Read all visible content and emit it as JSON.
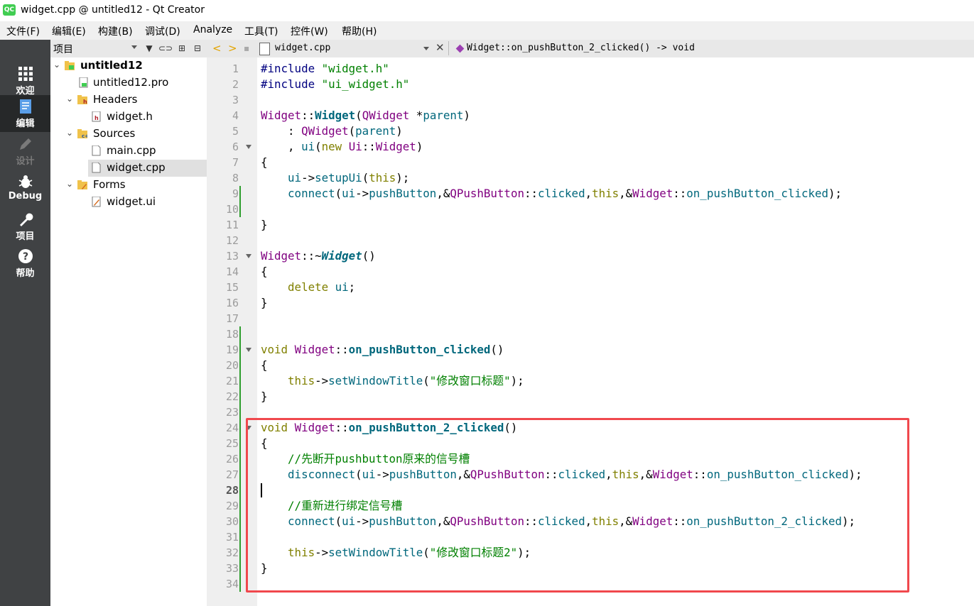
{
  "window": {
    "title": "widget.cpp @ untitled12 - Qt Creator",
    "app_icon_text": "QC"
  },
  "menubar": {
    "items": [
      "文件(F)",
      "编辑(E)",
      "构建(B)",
      "调试(D)",
      "Analyze",
      "工具(T)",
      "控件(W)",
      "帮助(H)"
    ]
  },
  "modebar": {
    "items": [
      {
        "label": "欢迎",
        "icon": "grid-icon"
      },
      {
        "label": "编辑",
        "icon": "document-edit-icon"
      },
      {
        "label": "设计",
        "icon": "pencil-icon"
      },
      {
        "label": "Debug",
        "icon": "bug-icon"
      },
      {
        "label": "项目",
        "icon": "wrench-icon"
      },
      {
        "label": "帮助",
        "icon": "question-icon"
      }
    ],
    "active": "编辑"
  },
  "project_panel": {
    "title": "项目",
    "tree": [
      {
        "label": "untitled12",
        "level": 0,
        "expanded": true,
        "icon": "project-folder-icon"
      },
      {
        "label": "untitled12.pro",
        "level": 1,
        "icon": "pro-file-icon"
      },
      {
        "label": "Headers",
        "level": 1,
        "expanded": true,
        "icon": "headers-folder-icon"
      },
      {
        "label": "widget.h",
        "level": 2,
        "icon": "header-file-icon"
      },
      {
        "label": "Sources",
        "level": 1,
        "expanded": true,
        "icon": "sources-folder-icon"
      },
      {
        "label": "main.cpp",
        "level": 2,
        "icon": "cpp-file-icon"
      },
      {
        "label": "widget.cpp",
        "level": 2,
        "icon": "cpp-file-icon",
        "selected": true
      },
      {
        "label": "Forms",
        "level": 1,
        "expanded": true,
        "icon": "forms-folder-icon"
      },
      {
        "label": "widget.ui",
        "level": 2,
        "icon": "ui-file-icon"
      }
    ]
  },
  "editor": {
    "file_name": "widget.cpp",
    "symbol": "Widget::on_pushButton_2_clicked() -> void",
    "current_line": 28,
    "line_numbers": [
      "1",
      "2",
      "3",
      "4",
      "5",
      "6",
      "7",
      "8",
      "9",
      "10",
      "11",
      "12",
      "13",
      "14",
      "15",
      "16",
      "17",
      "18",
      "19",
      "20",
      "21",
      "22",
      "23",
      "24",
      "25",
      "26",
      "27",
      "28",
      "29",
      "30",
      "31",
      "32",
      "33",
      "34"
    ],
    "lines": [
      "#include \"widget.h\"",
      "#include \"ui_widget.h\"",
      "",
      "Widget::Widget(QWidget *parent)",
      "    : QWidget(parent)",
      "    , ui(new Ui::Widget)",
      "{",
      "    ui->setupUi(this);",
      "    connect(ui->pushButton,&QPushButton::clicked,this,&Widget::on_pushButton_clicked);",
      "",
      "}",
      "",
      "Widget::~Widget()",
      "{",
      "    delete ui;",
      "}",
      "",
      "",
      "void Widget::on_pushButton_clicked()",
      "{",
      "    this->setWindowTitle(\"修改窗口标题\");",
      "}",
      "",
      "void Widget::on_pushButton_2_clicked()",
      "{",
      "    //先断开pushbutton原来的信号槽",
      "    disconnect(ui->pushButton,&QPushButton::clicked,this,&Widget::on_pushButton_clicked);",
      "",
      "    //重新进行绑定信号槽",
      "    connect(ui->pushButton,&QPushButton::clicked,this,&Widget::on_pushButton_2_clicked);",
      "",
      "    this->setWindowTitle(\"修改窗口标题2\");",
      "}",
      ""
    ]
  },
  "colors": {
    "highlight_box": "#f0484d",
    "modebar_bg": "#404244",
    "change_bar": "#2e9e2e"
  }
}
